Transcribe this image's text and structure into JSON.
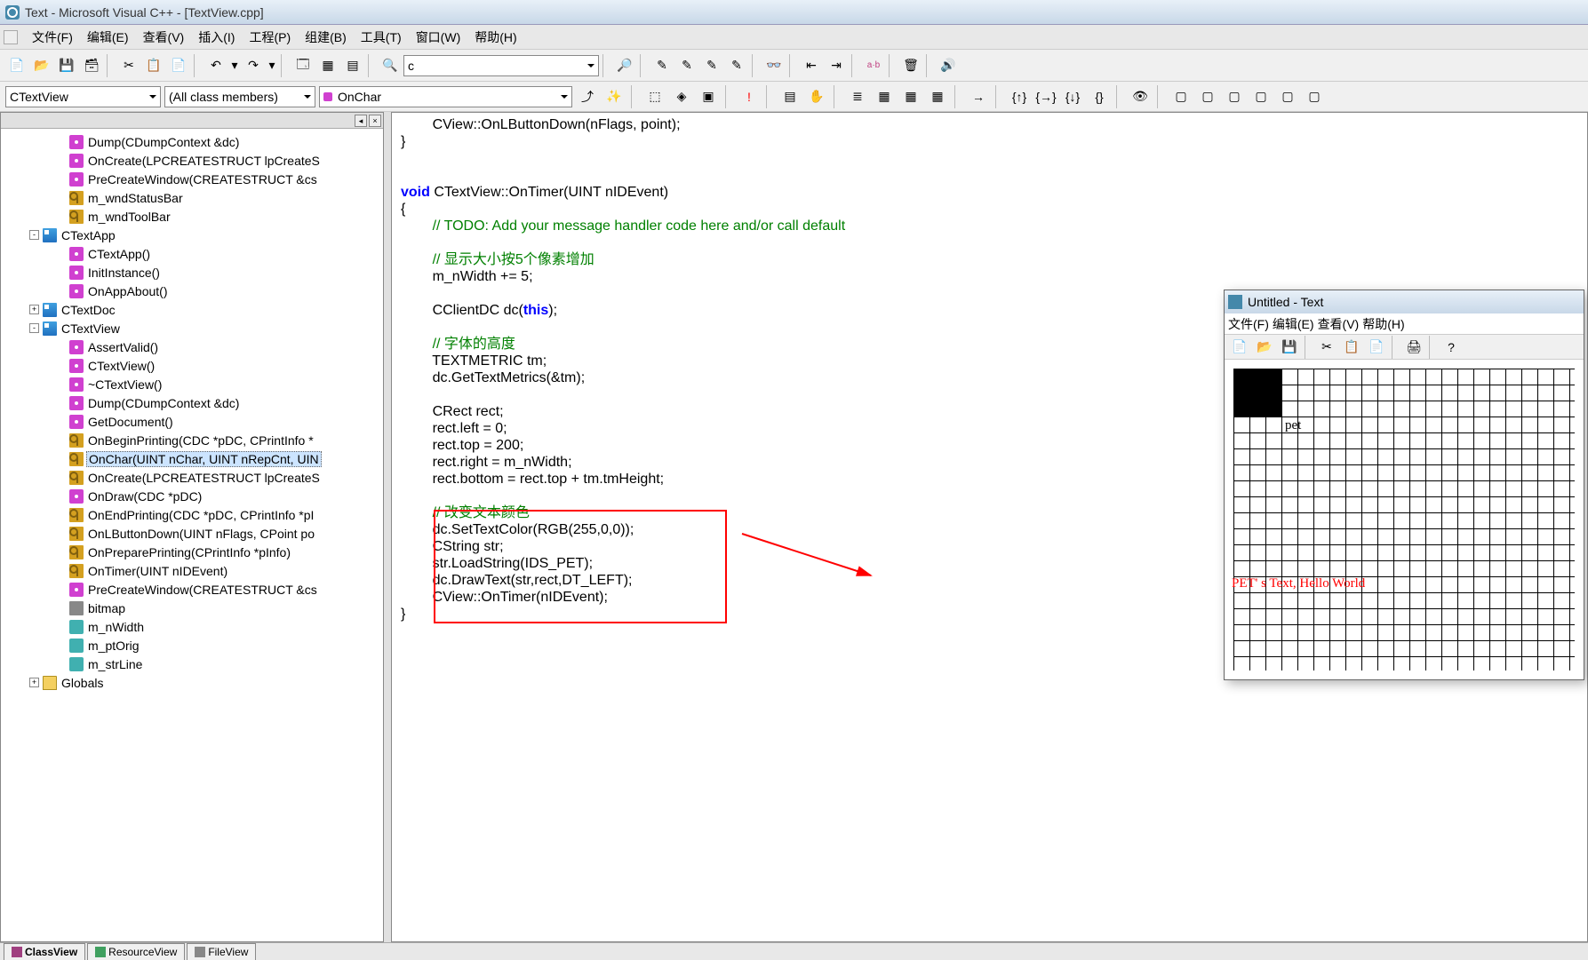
{
  "window": {
    "title": "Text - Microsoft Visual C++ - [TextView.cpp]"
  },
  "menu": {
    "file": "文件(F)",
    "edit": "编辑(E)",
    "view": "查看(V)",
    "insert": "插入(I)",
    "project": "工程(P)",
    "build": "组建(B)",
    "tools": "工具(T)",
    "window": "窗口(W)",
    "help": "帮助(H)"
  },
  "combo": {
    "class": "CTextView",
    "filter": "(All class members)",
    "member": "OnChar",
    "search": "c"
  },
  "tree": {
    "items": [
      {
        "ind": 60,
        "icon": "fn",
        "label": "Dump(CDumpContext &dc)"
      },
      {
        "ind": 60,
        "icon": "fn",
        "label": "OnCreate(LPCREATESTRUCT lpCreateS"
      },
      {
        "ind": 60,
        "icon": "fn",
        "label": "PreCreateWindow(CREATESTRUCT &cs"
      },
      {
        "ind": 60,
        "icon": "key",
        "label": "m_wndStatusBar"
      },
      {
        "ind": 60,
        "icon": "key",
        "label": "m_wndToolBar"
      },
      {
        "ind": 30,
        "exp": "-",
        "icon": "cls",
        "label": "CTextApp"
      },
      {
        "ind": 60,
        "icon": "fn",
        "label": "CTextApp()"
      },
      {
        "ind": 60,
        "icon": "fn",
        "label": "InitInstance()"
      },
      {
        "ind": 60,
        "icon": "fn",
        "label": "OnAppAbout()"
      },
      {
        "ind": 30,
        "exp": "+",
        "icon": "cls",
        "label": "CTextDoc"
      },
      {
        "ind": 30,
        "exp": "-",
        "icon": "cls",
        "label": "CTextView"
      },
      {
        "ind": 60,
        "icon": "fn",
        "label": "AssertValid()"
      },
      {
        "ind": 60,
        "icon": "fn",
        "label": "CTextView()"
      },
      {
        "ind": 60,
        "icon": "fn",
        "label": "~CTextView()"
      },
      {
        "ind": 60,
        "icon": "fn",
        "label": "Dump(CDumpContext &dc)"
      },
      {
        "ind": 60,
        "icon": "fn",
        "label": "GetDocument()"
      },
      {
        "ind": 60,
        "icon": "key",
        "label": "OnBeginPrinting(CDC *pDC, CPrintInfo *"
      },
      {
        "ind": 60,
        "icon": "key",
        "label": "OnChar(UINT nChar, UINT nRepCnt, UIN",
        "sel": true
      },
      {
        "ind": 60,
        "icon": "key",
        "label": "OnCreate(LPCREATESTRUCT lpCreateS"
      },
      {
        "ind": 60,
        "icon": "fn",
        "label": "OnDraw(CDC *pDC)"
      },
      {
        "ind": 60,
        "icon": "key",
        "label": "OnEndPrinting(CDC *pDC, CPrintInfo *pI"
      },
      {
        "ind": 60,
        "icon": "key",
        "label": "OnLButtonDown(UINT nFlags, CPoint po"
      },
      {
        "ind": 60,
        "icon": "key",
        "label": "OnPreparePrinting(CPrintInfo *pInfo)"
      },
      {
        "ind": 60,
        "icon": "key",
        "label": "OnTimer(UINT nIDEvent)"
      },
      {
        "ind": 60,
        "icon": "fn",
        "label": "PreCreateWindow(CREATESTRUCT &cs"
      },
      {
        "ind": 60,
        "icon": "lock",
        "label": "bitmap"
      },
      {
        "ind": 60,
        "icon": "var",
        "label": "m_nWidth"
      },
      {
        "ind": 60,
        "icon": "var",
        "label": "m_ptOrig"
      },
      {
        "ind": 60,
        "icon": "var",
        "label": "m_strLine"
      },
      {
        "ind": 30,
        "exp": "+",
        "icon": "folder",
        "label": "Globals"
      }
    ]
  },
  "tabs": {
    "classview": "ClassView",
    "resourceview": "ResourceView",
    "fileview": "FileView"
  },
  "code": {
    "l1": "        CView::OnLButtonDown(nFlags, point);",
    "l2": "}",
    "l3": "",
    "l4": "",
    "l5a": "void",
    "l5b": " CTextView::OnTimer(UINT nIDEvent)",
    "l6": "{",
    "l7": "        // TODO: Add your message handler code here and/or call default",
    "l8": "",
    "l9": "        // 显示大小按5个像素增加",
    "l10": "        m_nWidth += 5;",
    "l11": "",
    "l12a": "        CClientDC dc(",
    "l12b": "this",
    "l12c": ");",
    "l13": "",
    "l14": "        // 字体的高度",
    "l15": "        TEXTMETRIC tm;",
    "l16": "        dc.GetTextMetrics(&tm);",
    "l17": "",
    "l18": "        CRect rect;",
    "l19": "        rect.left = 0;",
    "l20": "        rect.top = 200;",
    "l21": "        rect.right = m_nWidth;",
    "l22": "        rect.bottom = rect.top + tm.tmHeight;",
    "l23": "",
    "l24": "        // 改变文本颜色",
    "l25": "        dc.SetTextColor(RGB(255,0,0));",
    "l26": "        CString str;",
    "l27": "        str.LoadString(IDS_PET);",
    "l28": "        dc.DrawText(str,rect,DT_LEFT);",
    "l29": "        CView::OnTimer(nIDEvent);",
    "l30": "}"
  },
  "child": {
    "title": "Untitled - Text",
    "menu": {
      "file": "文件(F)",
      "edit": "编辑(E)",
      "view": "查看(V)",
      "help": "帮助(H)"
    },
    "text1": "pet",
    "text2": "PET' s Text, Hello World"
  }
}
